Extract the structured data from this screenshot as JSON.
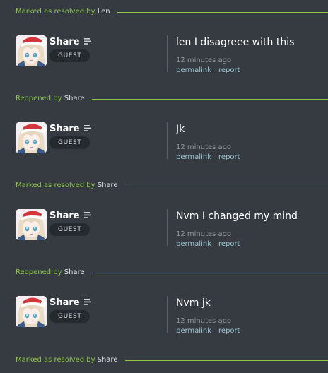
{
  "events": [
    {
      "verb": "Marked as resolved by",
      "actor": "Len"
    },
    {
      "verb": "Reopened by",
      "actor": "Share"
    },
    {
      "verb": "Marked as resolved by",
      "actor": "Share"
    },
    {
      "verb": "Reopened by",
      "actor": "Share"
    },
    {
      "verb": "Marked as resolved by",
      "actor": "Share"
    }
  ],
  "comments": [
    {
      "username": "Share",
      "role": "GUEST",
      "text": "len I disagreee with this",
      "time": "12 minutes ago",
      "permalink": "permalink",
      "report": "report"
    },
    {
      "username": "Share",
      "role": "GUEST",
      "text": "Jk",
      "time": "12 minutes ago",
      "permalink": "permalink",
      "report": "report"
    },
    {
      "username": "Share",
      "role": "GUEST",
      "text": "Nvm I changed my mind",
      "time": "12 minutes ago",
      "permalink": "permalink",
      "report": "report"
    },
    {
      "username": "Share",
      "role": "GUEST",
      "text": "Nvm jk",
      "time": "12 minutes ago",
      "permalink": "permalink",
      "report": "report"
    }
  ],
  "icons": {
    "role_icon": "list-icon",
    "avatar": "anime-girl-santa-hat-avatar"
  },
  "colors": {
    "background": "#363b41",
    "accent": "#8bc34a",
    "link": "#97c3d1",
    "badge_bg": "#252a2f"
  }
}
